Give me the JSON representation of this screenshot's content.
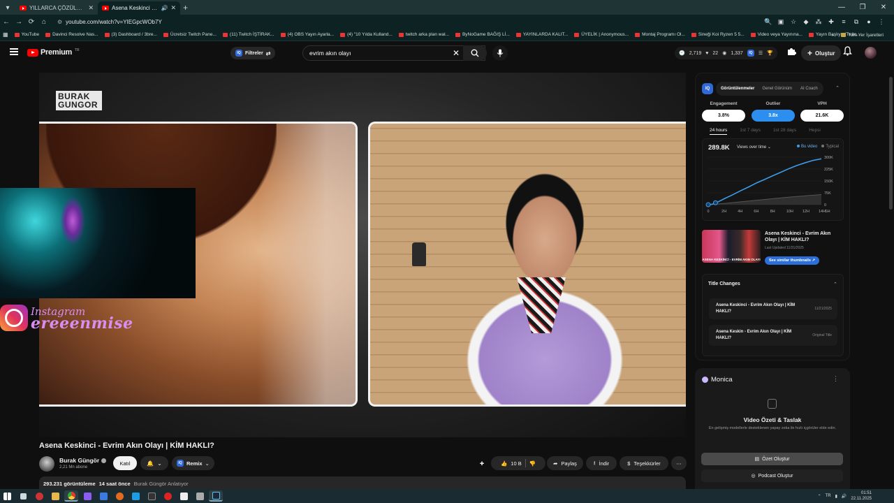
{
  "browser": {
    "tabs": [
      {
        "label": "YILLARCA ÇÖZÜLEMEYEN ÇİFT",
        "active": false
      },
      {
        "label": "Asena Keskinci - Evrim Akı",
        "active": true
      }
    ],
    "url": "youtube.com/watch?v=YIEGpcWOb7Y",
    "bookmarks": [
      "YouTube",
      "Davinci Resolve Nas...",
      "(3) Dashboard / 3bre...",
      "Ücretsiz Twitch Pane...",
      "(11) Twitch İŞTİRAK...",
      "(4) OBS Yayın Ayarla...",
      "(4) \"10 Yılda Kulland...",
      "twitch arka plan wal...",
      "ByNoGame BAĞIŞ Lİ...",
      "YAYINLARDA KALIT...",
      "ÜYELİK | Anonymous...",
      "Montaj Programı Ol...",
      "Sineği Koi Ryzen 5 5...",
      "Video veya Yayınına...",
      "Yayın Başlıyor/Twitc..."
    ],
    "bookmarks_overflow": "»",
    "bookmarks_folder": "Tüm Yer İşaretleri"
  },
  "yt": {
    "logo": "Premium",
    "logo_region": "TR",
    "filter_label": "Filtreler",
    "iq_badge": "IQ",
    "search_value": "evrim akın olayı",
    "stats": {
      "watched": "2,719",
      "liked": "22",
      "views": "1,337"
    },
    "create_label": "Oluştur"
  },
  "video": {
    "overlay_brand_1": "BURAK",
    "overlay_brand_2": "GUNGOR",
    "instagram_label": "Instagram",
    "instagram_handle": "ereeenmise",
    "title": "Asena Keskinci - Evrim Akın Olayı | KİM HAKLI?",
    "channel": "Burak Güngör",
    "subscribers": "2,21 Mn abone",
    "join_label": "Katıl",
    "remix_label": "Remix",
    "likes": "10 B",
    "share_label": "Paylaş",
    "download_label": "İndir",
    "thanks_label": "Teşekkürler",
    "views": "293.231 görüntüleme",
    "age": "14 saat önce",
    "uploader_note": "Burak Güngör Anlatıyor"
  },
  "iq_panel": {
    "tabs": [
      "Görüntülenmeler",
      "Genel Görünüm",
      "AI Coach"
    ],
    "metrics": [
      {
        "label": "Engagement",
        "value": "3.8%"
      },
      {
        "label": "Outlier",
        "value": "3.8x"
      },
      {
        "label": "VPH",
        "value": "21.6K"
      }
    ],
    "ranges": [
      "24 hours",
      "1st 7 days",
      "1st 28 days",
      "Hepsi"
    ],
    "views_total": "289.8K",
    "views_selector": "Views over time",
    "legend": {
      "this_video": "Bu video",
      "typical": "Typical"
    },
    "thumb_title": "Asena Keskinci - Evrim Akın Olayı | KİM HAKLI?",
    "thumb_caption": "ASENA KESKİNCİ - EVRİM AKIN OLAYI",
    "thumb_updated": "Last Updated 11/21/2025",
    "see_thumbs": "See similar thumbnails",
    "title_changes_header": "Title Changes",
    "title_changes": [
      {
        "title": "Asena Keskinci - Evrim Akın Olayı | KİM HAKLI?",
        "date": "11/21/2025"
      },
      {
        "title": "Asena Keskin - Evrim Akın Olayı | KİM HAKLI?",
        "date": "Original Title"
      }
    ]
  },
  "chart_data": {
    "type": "line",
    "x_tick_labels": [
      "0",
      "2H",
      "4H",
      "6H",
      "8H",
      "10H",
      "12H",
      "14H"
    ],
    "y_tick_labels": [
      "300K",
      "225K",
      "150K",
      "75K",
      "0"
    ],
    "extra_x_label": "SH",
    "ylim": [
      0,
      300000
    ],
    "series": [
      {
        "name": "Bu video",
        "x": [
          0,
          0.5,
          1,
          2,
          3,
          4,
          5,
          6,
          7,
          8,
          9,
          10,
          11,
          12,
          13,
          14
        ],
        "values": [
          0,
          3000,
          12000,
          38000,
          62000,
          88000,
          112000,
          138000,
          160000,
          183000,
          205000,
          228000,
          248000,
          265000,
          280000,
          289800
        ]
      },
      {
        "name": "Typical",
        "x": [
          0,
          2,
          4,
          6,
          8,
          10,
          12,
          14
        ],
        "values": [
          0,
          8000,
          18000,
          28000,
          38000,
          48000,
          56000,
          64000
        ]
      }
    ],
    "colors": {
      "this_video": "#3d9be9",
      "typical": "#555555"
    }
  },
  "monica": {
    "name": "Monica",
    "title": "Video Özeti & Taslak",
    "description": "En gelişmiş modellerle desteklenen yapay zeka ile hızlı içgörüler elde edin.",
    "summary_button": "Özet Oluştur",
    "podcast_button": "Podcast Oluştur"
  },
  "taskbar": {
    "time": "01:51",
    "date": "22.11.2025",
    "lang": "TR"
  }
}
